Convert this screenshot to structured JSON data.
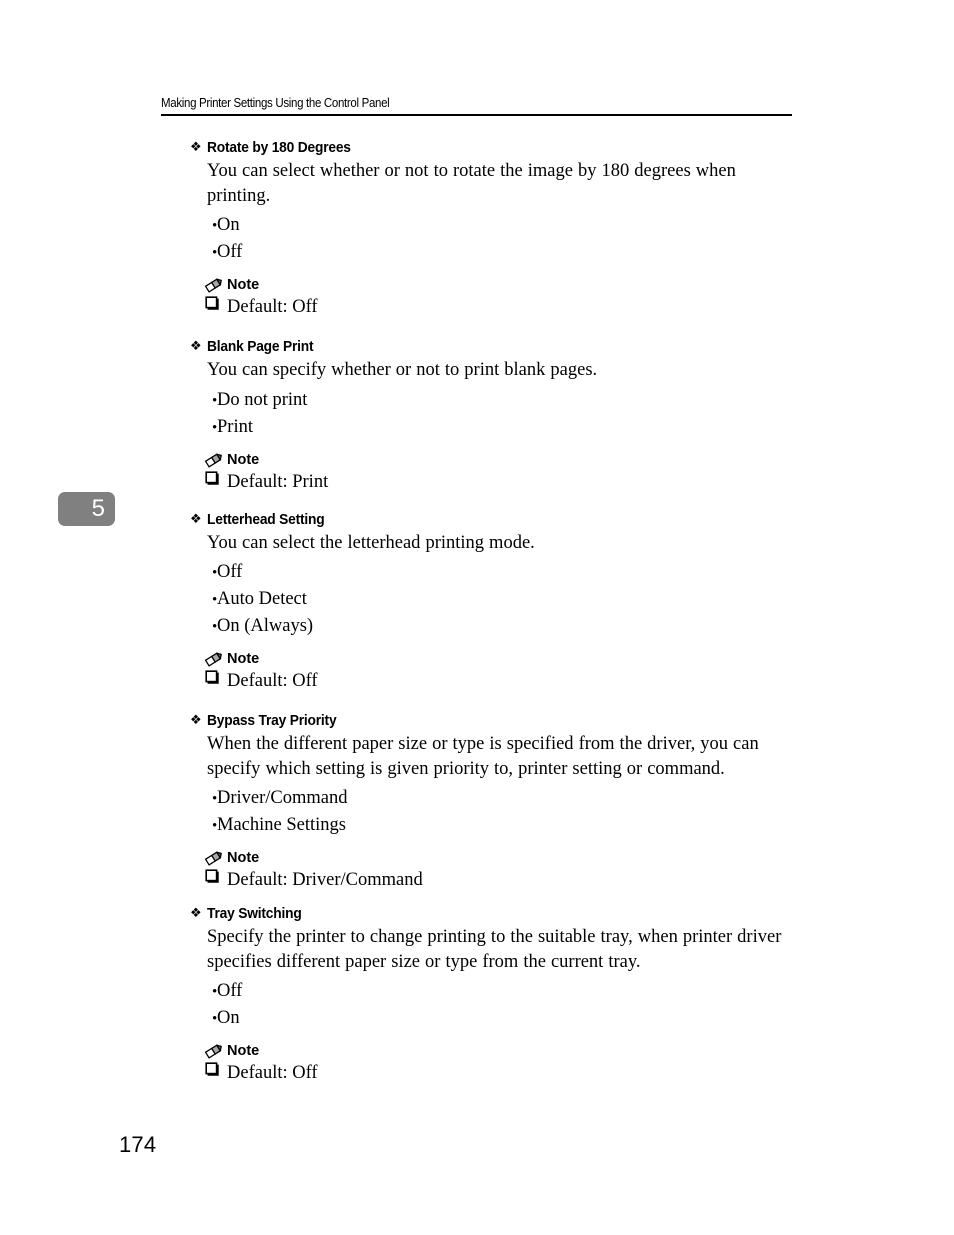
{
  "header": {
    "running_head": "Making Printer Settings Using the Control Panel"
  },
  "chapter_tab": {
    "number": "5",
    "background_color": "#808080",
    "text_color": "#ffffff"
  },
  "folio": {
    "page_number": "174"
  },
  "icons": {
    "section_bullet": "diamond-bullet-icon",
    "option_bullet": "round-bullet-icon",
    "note_marker": "pencil-icon",
    "note_item_bullet": "open-square-icon"
  },
  "sections": [
    {
      "title": "Rotate by 180 Degrees",
      "description": "You can select whether or not to rotate the image by 180 degrees when printing.",
      "options": [
        "On",
        "Off"
      ],
      "note": {
        "label": "Note",
        "items": [
          "Default: Off"
        ]
      }
    },
    {
      "title": "Blank Page Print",
      "description": "You can specify whether or not to print blank pages.",
      "options": [
        "Do not print",
        "Print"
      ],
      "note": {
        "label": "Note",
        "items": [
          "Default: Print"
        ]
      }
    },
    {
      "title": "Letterhead Setting",
      "description": "You can select the letterhead printing mode.",
      "options": [
        "Off",
        "Auto Detect",
        "On (Always)"
      ],
      "note": {
        "label": "Note",
        "items": [
          "Default: Off"
        ]
      }
    },
    {
      "title": "Bypass Tray Priority",
      "description": "When the different paper size or type is specified from the driver, you can specify which setting is given priority to, printer setting or command.",
      "options": [
        "Driver/Command",
        "Machine Settings"
      ],
      "note": {
        "label": "Note",
        "items": [
          "Default: Driver/Command"
        ]
      }
    },
    {
      "title": "Tray Switching",
      "description": "Specify the printer to change printing to the suitable tray, when printer driver specifies different paper size or type from the current tray.",
      "options": [
        "Off",
        "On"
      ],
      "note": {
        "label": "Note",
        "items": [
          "Default: Off"
        ]
      }
    }
  ]
}
